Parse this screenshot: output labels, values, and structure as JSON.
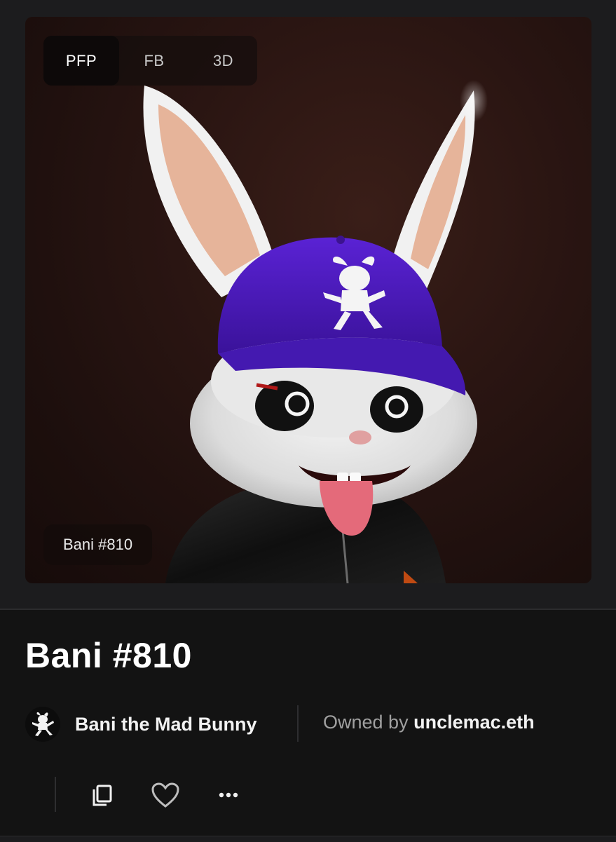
{
  "media": {
    "view_tabs": [
      {
        "label": "PFP",
        "active": true
      },
      {
        "label": "FB",
        "active": false
      },
      {
        "label": "3D",
        "active": false
      }
    ],
    "token_pill": "Bani #810",
    "image_subject": "3D rabbit wearing purple cap with rabbit logo and black jacket, tongue out"
  },
  "item": {
    "title": "Bani #810",
    "collection": {
      "name": "Bani the Mad Bunny",
      "avatar_icon": "bunny-logo-icon"
    },
    "owned_by_label": "Owned by",
    "owner": "unclemac.eth"
  },
  "actions": [
    {
      "name": "copy",
      "icon": "copy-icon"
    },
    {
      "name": "favorite",
      "icon": "heart-icon"
    },
    {
      "name": "more",
      "icon": "more-dots-icon"
    }
  ],
  "colors": {
    "background": "#131313",
    "panel": "#1c1c1e",
    "cap_purple": "#4a1ab8",
    "muted_text": "#a0a0a0"
  }
}
